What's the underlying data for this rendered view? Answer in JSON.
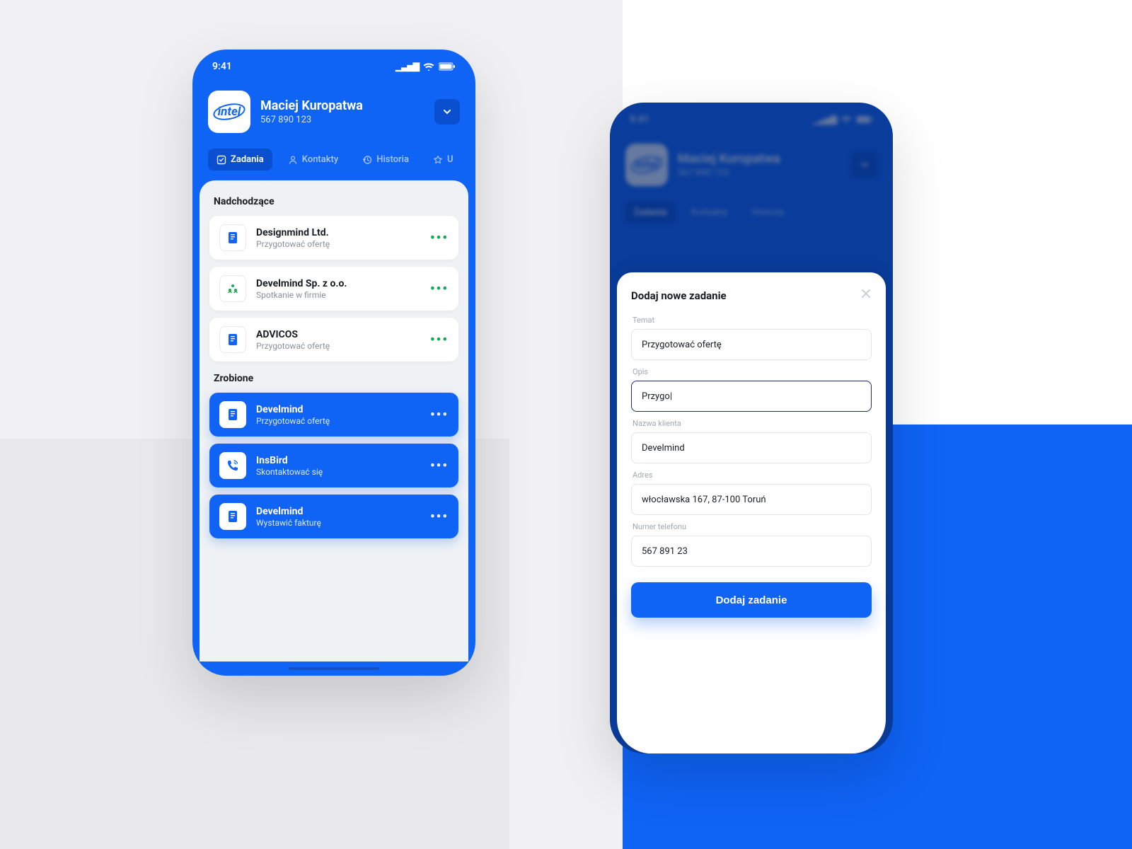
{
  "statusbar": {
    "time": "9:41"
  },
  "contact": {
    "name": "Maciej Kuropatwa",
    "phone": "567 890 123",
    "avatar_logo": "intel"
  },
  "tabs": [
    {
      "label": "Zadania",
      "active": true
    },
    {
      "label": "Kontakty",
      "active": false
    },
    {
      "label": "Historia",
      "active": false
    },
    {
      "label": "U",
      "active": false
    }
  ],
  "sections": {
    "upcoming_title": "Nadchodzące",
    "done_title": "Zrobione"
  },
  "upcoming": [
    {
      "company": "Designmind Ltd.",
      "task": "Przygotować ofertę",
      "icon": "doc-blue"
    },
    {
      "company": "Develmind Sp. z o.o.",
      "task": "Spotkanie w firmie",
      "icon": "meeting-green"
    },
    {
      "company": "ADVICOS",
      "task": "Przygotować ofertę",
      "icon": "doc-blue"
    }
  ],
  "done": [
    {
      "company": "Develmind",
      "task": "Przygotować ofertę",
      "icon": "doc-blue"
    },
    {
      "company": "InsBird",
      "task": "Skontaktować się",
      "icon": "call-blue"
    },
    {
      "company": "Develmind",
      "task": "Wystawić fakturę",
      "icon": "doc-blue"
    }
  ],
  "sheet": {
    "title": "Dodaj nowe zadanie",
    "labels": {
      "topic": "Temat",
      "desc": "Opis",
      "client": "Nazwa klienta",
      "address": "Adres",
      "phone": "Numer telefonu"
    },
    "values": {
      "topic": "Przygotować ofertę",
      "desc": "Przygo|",
      "client": "Develmind",
      "address": "włocławska 167, 87-100 Toruń",
      "phone": "567 891 23"
    },
    "submit": "Dodaj zadanie"
  }
}
